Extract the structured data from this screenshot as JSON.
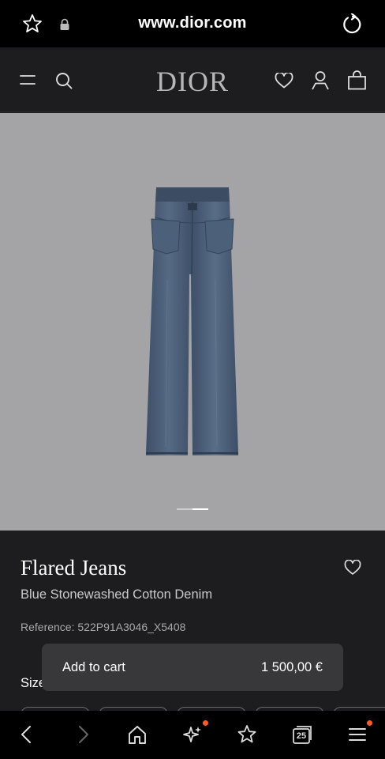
{
  "browser": {
    "url": "www.dior.com"
  },
  "site": {
    "logo": "DIOR"
  },
  "product": {
    "title": "Flared Jeans",
    "subtitle": "Blue Stonewashed Cotton Denim",
    "reference": "Reference: 522P91A3046_X5408",
    "size_label": "Size",
    "carousel": {
      "count": 2,
      "active": 2
    }
  },
  "cart": {
    "label": "Add to cart",
    "price": "1 500,00 €"
  },
  "bottom_nav": {
    "tabs_count": "25",
    "items": [
      "back-icon",
      "forward-icon",
      "home-icon",
      "sparkle-icon",
      "favorites-icon",
      "tabs-icon",
      "menu-icon"
    ]
  },
  "colors": {
    "accent_notification": "#ff5a1f",
    "image_background": "#a4a4a6",
    "page_background": "#1d1d1f"
  }
}
